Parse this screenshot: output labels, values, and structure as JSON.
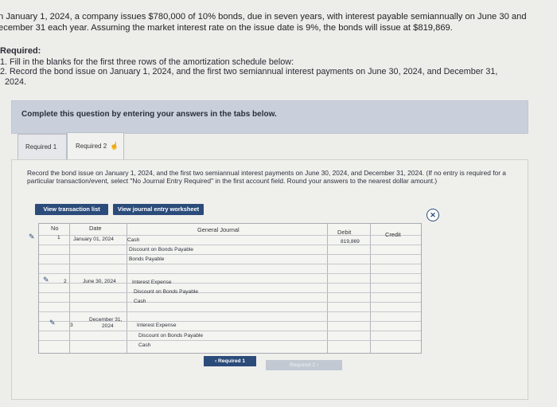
{
  "problem": {
    "line1": "n January 1, 2024, a company issues $780,000 of 10% bonds, due in seven years, with interest payable semiannually on June 30 and",
    "line2": "ecember 31 each year. Assuming the market interest rate on the issue date is 9%, the bonds will issue at $819,869."
  },
  "required": {
    "heading": "Required:",
    "item1": "1. Fill in the blanks for the first three rows of the amortization schedule below:",
    "item2": "2. Record the bond issue on January 1, 2024, and the first two semiannual interest payments on June 30, 2024, and December 31,",
    "item2_cont": "2024."
  },
  "banner": {
    "text": "Complete this question by entering your answers in the tabs below."
  },
  "tabs": {
    "tab1": "Required 1",
    "tab2": "Required 2"
  },
  "instruction": "Record the bond issue on January 1, 2024, and the first two semiannual interest payments on June 30, 2024, and December 31, 2024. (If no entry is required for a particular transaction/event, select \"No Journal Entry Required\" in the first account field. Round your answers to the nearest dollar amount.)",
  "buttons": {
    "view_transaction": "View transaction list",
    "view_journal": "View journal entry worksheet"
  },
  "journal": {
    "headers": {
      "no": "No",
      "date": "Date",
      "general_journal": "General Journal",
      "debit": "Debit",
      "credit": "Credit"
    },
    "entries": [
      {
        "no": "1",
        "date": "January 01, 2024",
        "accounts": [
          "Cash",
          "Discount on Bonds Payable",
          "Bonds Payable"
        ],
        "debit": "819,869"
      },
      {
        "no": "2",
        "date": "June 30, 2024",
        "accounts": [
          "Interest Expense",
          "Discount on Bonds Payable",
          "Cash"
        ]
      },
      {
        "no": "3",
        "date_line1": "December 31,",
        "date_line2": "2024",
        "accounts": [
          "Interest Expense",
          "Discount on Bonds Payable",
          "Cash"
        ]
      }
    ]
  },
  "nav": {
    "prev": "Required 1",
    "next": "Required 2"
  }
}
